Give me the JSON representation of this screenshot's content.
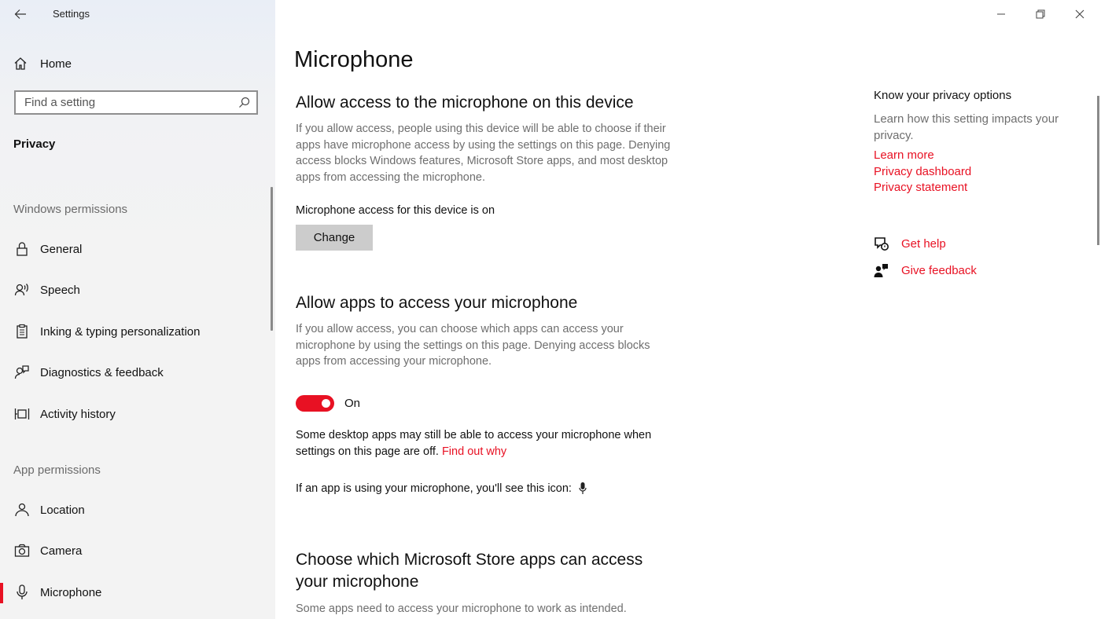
{
  "app_title": "Settings",
  "sidebar": {
    "home_label": "Home",
    "search_placeholder": "Find a setting",
    "section_title": "Privacy",
    "windows_permissions_label": "Windows permissions",
    "windows_items": [
      {
        "label": "General",
        "icon": "lock-icon"
      },
      {
        "label": "Speech",
        "icon": "speech-icon"
      },
      {
        "label": "Inking & typing personalization",
        "icon": "clipboard-icon"
      },
      {
        "label": "Diagnostics & feedback",
        "icon": "diagnostics-icon"
      },
      {
        "label": "Activity history",
        "icon": "timeline-icon"
      }
    ],
    "app_permissions_label": "App permissions",
    "app_items": [
      {
        "label": "Location",
        "icon": "location-icon"
      },
      {
        "label": "Camera",
        "icon": "camera-icon"
      },
      {
        "label": "Microphone",
        "icon": "microphone-icon",
        "active": true
      }
    ]
  },
  "main": {
    "page_title": "Microphone",
    "device_section": {
      "heading": "Allow access to the microphone on this device",
      "description": "If you allow access, people using this device will be able to choose if their apps have microphone access by using the settings on this page. Denying access blocks Windows features, Microsoft Store apps, and most desktop apps from accessing the microphone.",
      "status": "Microphone access for this device is on",
      "change_button": "Change"
    },
    "apps_section": {
      "heading": "Allow apps to access your microphone",
      "description": "If you allow access, you can choose which apps can access your microphone by using the settings on this page. Denying access blocks apps from accessing your microphone.",
      "toggle_state": "On",
      "toggle_on": true,
      "desktop_note": "Some desktop apps may still be able to access your microphone when settings on this page are off.",
      "find_out_why": "Find out why",
      "icon_note": "If an app is using your microphone, you'll see this icon:"
    },
    "store_section": {
      "heading": "Choose which Microsoft Store apps can access your microphone",
      "description": "Some apps need to access your microphone to work as intended."
    }
  },
  "right_panel": {
    "title": "Know your privacy options",
    "description": "Learn how this setting impacts your privacy.",
    "links": [
      "Learn more",
      "Privacy dashboard",
      "Privacy statement"
    ],
    "get_help": "Get help",
    "give_feedback": "Give feedback"
  },
  "colors": {
    "accent": "#e81123",
    "sidebar_bg": "#f3f3f3",
    "button_bg": "#cccccc",
    "secondary_text": "#6e6e6e"
  }
}
